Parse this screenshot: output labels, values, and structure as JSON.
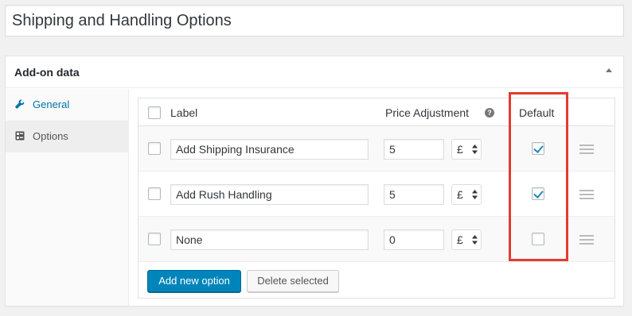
{
  "title_field": {
    "value": "Shipping and Handling Options"
  },
  "metabox": {
    "title": "Add-on data"
  },
  "tabs": [
    {
      "label": "General",
      "icon": "wrench-icon",
      "active": true
    },
    {
      "label": "Options",
      "icon": "options-icon",
      "active": false
    }
  ],
  "table": {
    "headers": {
      "label": "Label",
      "price": "Price Adjustment",
      "help": "?",
      "default": "Default"
    },
    "rows": [
      {
        "label": "Add Shipping Insurance",
        "price": "5",
        "currency": "£",
        "default_checked": true
      },
      {
        "label": "Add Rush Handling",
        "price": "5",
        "currency": "£",
        "default_checked": true
      },
      {
        "label": "None",
        "price": "0",
        "currency": "£",
        "default_checked": false
      }
    ]
  },
  "buttons": {
    "add_new": "Add new option",
    "delete_selected": "Delete selected"
  },
  "colors": {
    "primary": "#0085ba",
    "link": "#0073aa",
    "highlight": "#e53a2e",
    "check": "#1e8cbe"
  }
}
